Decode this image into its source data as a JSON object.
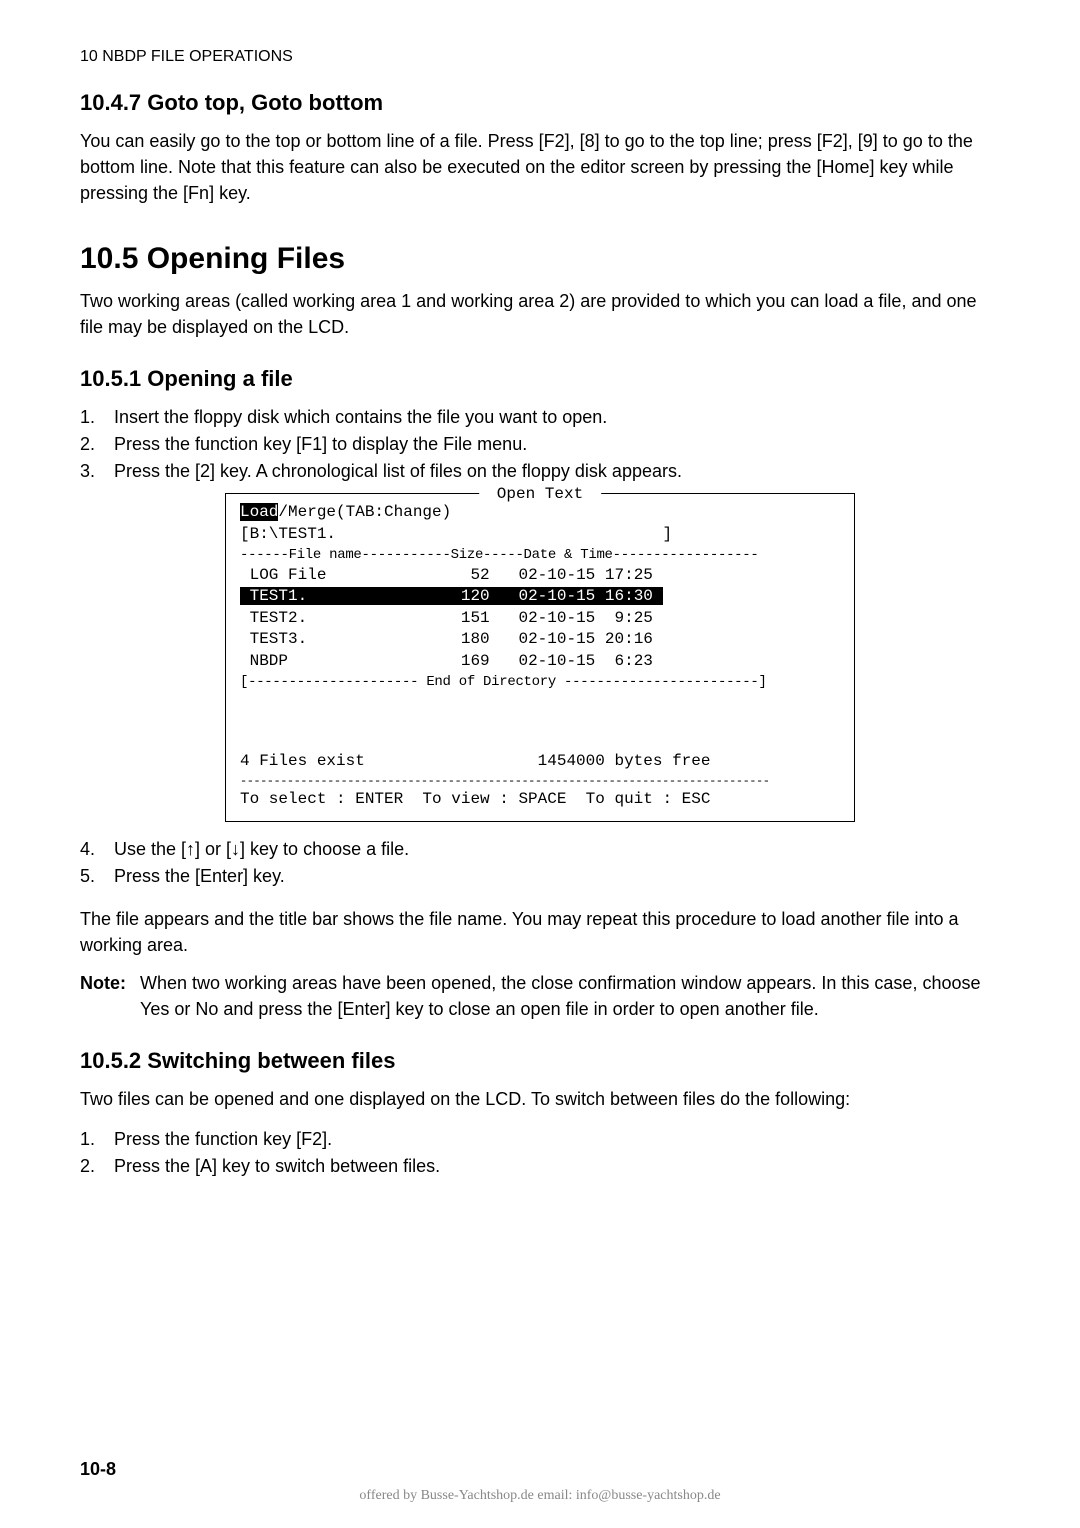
{
  "header": "10   NBDP FILE OPERATIONS",
  "s1": {
    "title": "10.4.7 Goto top, Goto bottom",
    "para": "You can easily go to the top or bottom line of a file. Press [F2], [8] to go to the top line; press [F2], [9] to go to the bottom line. Note that this feature can also be executed on the editor screen by pressing the [Home] key while pressing the [Fn] key."
  },
  "s2": {
    "title": "10.5 Opening Files",
    "para": "Two working areas (called working area 1 and working area 2) are provided to which you can load a file, and one file may be displayed on the LCD."
  },
  "s3": {
    "title": "10.5.1 Opening a file",
    "items": [
      {
        "n": "1.",
        "t": "Insert the floppy disk which contains the file you want to open."
      },
      {
        "n": "2.",
        "t": "Press the function key [F1] to display the File menu."
      },
      {
        "n": "3.",
        "t": "Press the [2] key. A chronological list of files on the floppy disk appears."
      }
    ],
    "items2": [
      {
        "n": "4.",
        "t": "Use the [↑] or [↓] key to choose a file."
      },
      {
        "n": "5.",
        "t": "Press the [Enter] key."
      }
    ],
    "para2": "The file appears and the title bar shows the file name. You may repeat this procedure to load another file into a working area.",
    "noteLabel": "Note:",
    "noteText": "When two working areas have been opened, the close confirmation window appears. In this case, choose Yes or No and press the [Enter] key to close an open file in order to open another file."
  },
  "terminal": {
    "title": " Open Text ",
    "loadLabel": "Load",
    "loadRest": "/Merge(TAB:Change)",
    "path": "[B:\\TEST1.                                  ]",
    "hdr": "------File name-----------Size-----Date & Time------------------",
    "rows": [
      {
        "name": " LOG File",
        "size": "  52",
        "dt": "02-10-15 17:25",
        "hl": false
      },
      {
        "name": " TEST1.  ",
        "size": " 120",
        "dt": "02-10-15 16:30",
        "hl": true
      },
      {
        "name": " TEST2.  ",
        "size": " 151",
        "dt": "02-10-15  9:25",
        "hl": false
      },
      {
        "name": " TEST3.  ",
        "size": " 180",
        "dt": "02-10-15 20:16",
        "hl": false
      },
      {
        "name": " NBDP    ",
        "size": " 169",
        "dt": "02-10-15  6:23",
        "hl": false
      }
    ],
    "eod": "[--------------------- End of Directory ------------------------]",
    "status": "4 Files exist                  1454000 bytes free",
    "sep": "-------------------------------------------------------------------------------",
    "help": "To select : ENTER  To view : SPACE  To quit : ESC"
  },
  "s4": {
    "title": "10.5.2 Switching between files",
    "para": "Two files can be opened and one displayed on the LCD. To switch between files do the following:",
    "items": [
      {
        "n": "1.",
        "t": "Press the function key [F2]."
      },
      {
        "n": "2.",
        "t": "Press the [A] key to switch between files."
      }
    ]
  },
  "pageNum": "10-8",
  "footer": "offered by Busse-Yachtshop.de      email: info@busse-yachtshop.de"
}
